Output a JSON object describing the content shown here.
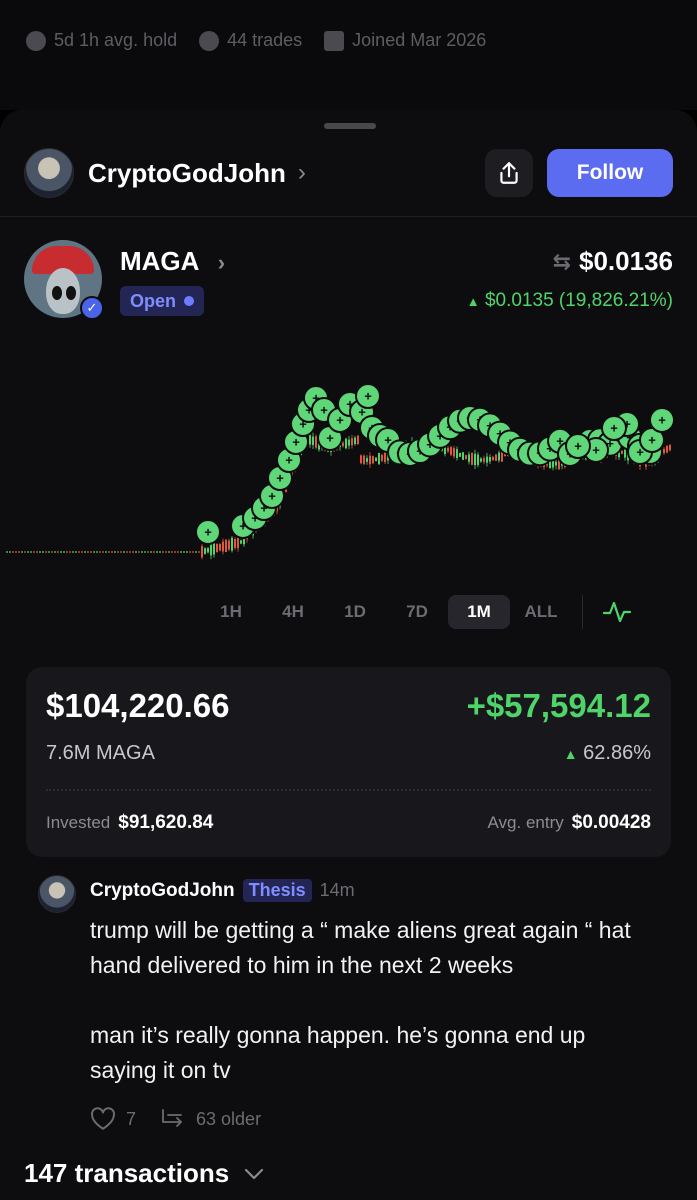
{
  "profile_stats": {
    "avg_hold": "5d 1h avg. hold",
    "trades": "44 trades",
    "joined": "Joined Mar 2026"
  },
  "header": {
    "username": "CryptoGodJohn",
    "follow_label": "Follow"
  },
  "token": {
    "name": "MAGA",
    "status": "Open",
    "price": "$0.0136",
    "change": "$0.0135 (19,826.21%)",
    "avatar_text": "MAKE ALIENS GREAT AGAIN"
  },
  "timeframes": {
    "items": [
      "1H",
      "4H",
      "1D",
      "7D",
      "1M",
      "ALL"
    ],
    "active": "1M"
  },
  "position": {
    "value": "$104,220.66",
    "pnl": "+$57,594.12",
    "quantity": "7.6M MAGA",
    "pnl_percent": "62.86%",
    "invested_label": "Invested",
    "invested": "$91,620.84",
    "avg_entry_label": "Avg. entry",
    "avg_entry": "$0.00428"
  },
  "post": {
    "author": "CryptoGodJohn",
    "tag": "Thesis",
    "time": "14m",
    "body": "trump will be getting a “ make aliens great again “ hat hand delivered to him in the next 2 weeks\n\nman it’s really gonna happen. he’s gonna end up saying it on tv",
    "likes": "7",
    "older": "63 older"
  },
  "transactions": {
    "label": "147 transactions"
  },
  "colors": {
    "accent": "#5b6cf0",
    "positive": "#4fd46a",
    "negative": "#e0583a",
    "background": "#0d0d10",
    "card": "#18181c"
  }
}
